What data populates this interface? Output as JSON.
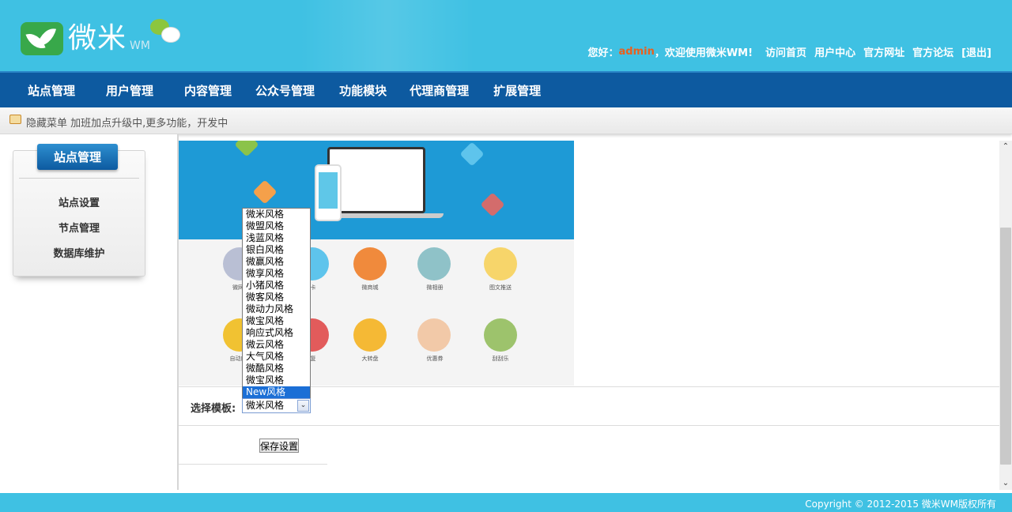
{
  "header": {
    "logo_text": "微米",
    "logo_sub": "WM",
    "greeting_prefix": "您好：",
    "username": "admin",
    "greeting_suffix": "，欢迎使用微米WM!",
    "links": [
      "访问首页",
      "用户中心",
      "官方网址",
      "官方论坛",
      "[退出]"
    ]
  },
  "nav": {
    "items": [
      "站点管理",
      "用户管理",
      "内容管理",
      "公众号管理",
      "功能模块",
      "代理商管理",
      "扩展管理"
    ]
  },
  "tipbar": {
    "text": "隐藏菜单 加班加点升级中,更多功能，开发中"
  },
  "sidebar": {
    "title": "站点管理",
    "items": [
      "站点设置",
      "节点管理",
      "数据库维护"
    ]
  },
  "form": {
    "template_label": "选择模板:",
    "selected_value": "微米风格",
    "options": [
      "微米风格",
      "微盟风格",
      "浅蓝风格",
      "银白风格",
      "微赢风格",
      "微享风格",
      "小猪风格",
      "微客风格",
      "微动力风格",
      "微宝风格",
      "响应式风格",
      "微云风格",
      "大气风格",
      "微酷风格",
      "微宝风格",
      "New风格"
    ],
    "highlighted_option": "New风格",
    "save_label": "保存设置"
  },
  "preview_captions": {
    "row1": [
      "微网",
      "卡",
      "微商城",
      "微相册",
      "图文推送"
    ],
    "row2": [
      "自动应",
      "复",
      "大转盘",
      "优惠券",
      "刮刮乐"
    ]
  },
  "footer": {
    "copyright": "Copyright © 2012-2015 微米WM版权所有"
  },
  "colors": {
    "header_bg": "#3fc1e3",
    "nav_bg": "#0d5aa0",
    "username_color": "#e9601e",
    "option_highlight": "#1b6fd6"
  }
}
